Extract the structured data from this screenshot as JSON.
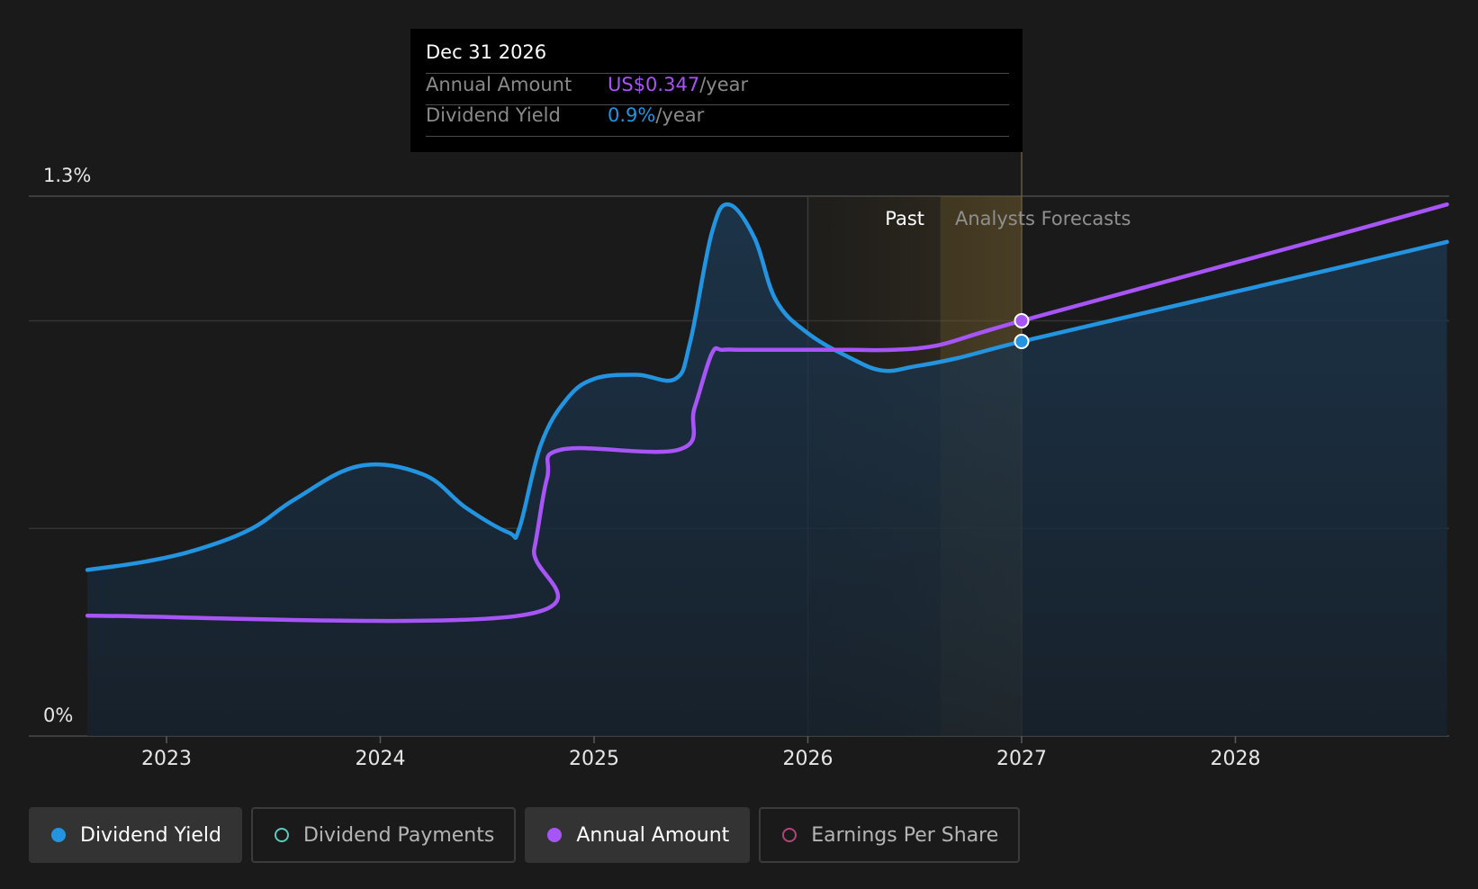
{
  "tooltip": {
    "date": "Dec 31 2026",
    "rows": [
      {
        "label": "Annual Amount",
        "value": "US$0.347",
        "unit": "/year"
      },
      {
        "label": "Dividend Yield",
        "value": "0.9%",
        "unit": "/year"
      }
    ]
  },
  "regions": {
    "past": "Past",
    "forecast": "Analysts Forecasts"
  },
  "legend": [
    {
      "label": "Dividend Yield",
      "active": true
    },
    {
      "label": "Dividend Payments",
      "active": false
    },
    {
      "label": "Annual Amount",
      "active": true
    },
    {
      "label": "Earnings Per Share",
      "active": false
    }
  ],
  "colors": {
    "dividend_yield": "#2394e0",
    "dividend_payments": "#5fc9bd",
    "annual_amount": "#a855f7",
    "earnings_per_share": "#b0457d",
    "forecast_band": "#7a6330"
  },
  "chart_data": {
    "type": "line",
    "ylim": [
      0,
      1.3
    ],
    "y_tick_labels": [
      {
        "value": 1.3,
        "label": "1.3%"
      },
      {
        "value": 0,
        "label": "0%"
      }
    ],
    "x_tick_labels": [
      "2023",
      "2024",
      "2025",
      "2026",
      "2027",
      "2028"
    ],
    "xlim": [
      2022.36,
      2028.99
    ],
    "gridlines": [
      0.5,
      1.0,
      1.3
    ],
    "past_start": 2026.0,
    "forecast_start": 2027.0,
    "highlight_date": 2027.0,
    "series": [
      {
        "name": "Dividend Yield",
        "x": [
          2022.63,
          2022.9,
          2023.15,
          2023.4,
          2023.6,
          2023.9,
          2024.2,
          2024.4,
          2024.6,
          2024.65,
          2024.75,
          2024.87,
          2025.0,
          2025.2,
          2025.38,
          2025.45,
          2025.55,
          2025.63,
          2025.75,
          2025.85,
          2026.0,
          2026.2,
          2026.35,
          2026.5,
          2026.7,
          2027.0,
          2027.5,
          2028.0,
          2028.5,
          2028.99
        ],
        "y": [
          0.4,
          0.42,
          0.45,
          0.5,
          0.57,
          0.65,
          0.63,
          0.55,
          0.49,
          0.5,
          0.7,
          0.81,
          0.86,
          0.87,
          0.86,
          0.95,
          1.21,
          1.28,
          1.2,
          1.05,
          0.97,
          0.91,
          0.88,
          0.89,
          0.91,
          0.95,
          1.01,
          1.07,
          1.13,
          1.19
        ]
      },
      {
        "name": "Annual Amount",
        "x": [
          2022.63,
          2024.65,
          2024.72,
          2024.78,
          2024.85,
          2025.4,
          2025.47,
          2025.55,
          2025.6,
          2025.7,
          2026.0,
          2026.2,
          2026.4,
          2026.6,
          2026.8,
          2027.0,
          2027.5,
          2028.0,
          2028.5,
          2028.99
        ],
        "y": [
          0.29,
          0.29,
          0.45,
          0.62,
          0.69,
          0.69,
          0.79,
          0.92,
          0.93,
          0.93,
          0.93,
          0.93,
          0.93,
          0.94,
          0.97,
          1.0,
          1.07,
          1.14,
          1.21,
          1.28
        ]
      }
    ]
  }
}
